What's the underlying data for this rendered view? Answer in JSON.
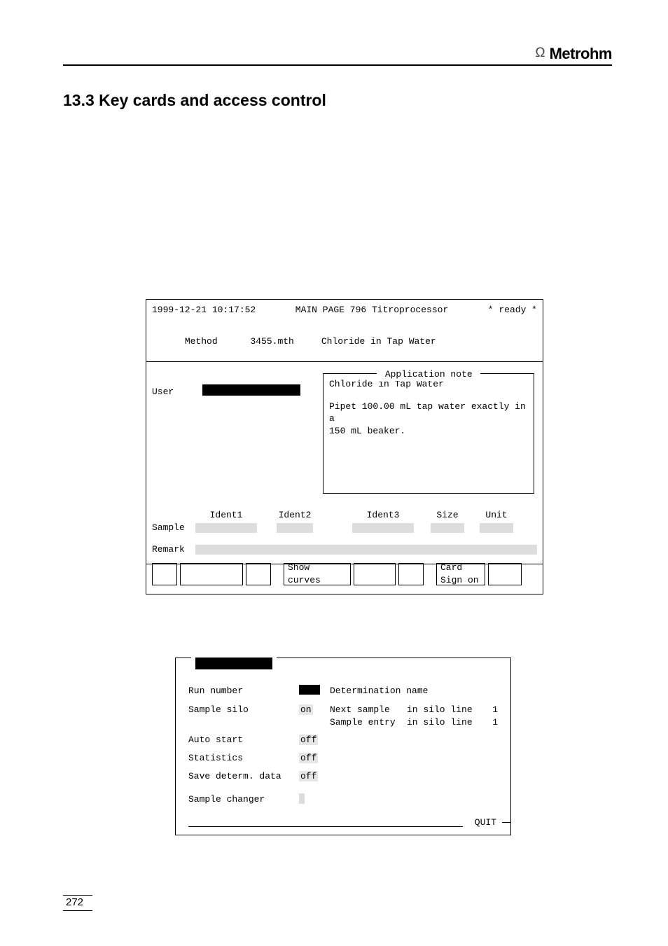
{
  "header": {
    "brand": "Metrohm"
  },
  "section": {
    "number": "13.3",
    "title": "Key cards and access control"
  },
  "panel": {
    "datetime": "1999-12-21 10:17:52",
    "main_page": "MAIN PAGE 796 Titroprocessor",
    "status": "* ready *",
    "method_label": "Method",
    "method_file": "3455.mth",
    "method_name": "Chloride in Tap Water",
    "user_label": "User",
    "note_title": "Application note",
    "note_line1": "Chloride in Tap Water",
    "note_line2": "Pipet 100.00 mL tap water exactly in a",
    "note_line3": "150 mL beaker.",
    "ident_headers": {
      "ident1": "Ident1",
      "ident2": "Ident2",
      "ident3": "Ident3",
      "size": "Size",
      "unit": "Unit"
    },
    "labels": {
      "sample": "Sample",
      "remark": "Remark"
    },
    "buttons": {
      "show_curves": "Show\ncurves",
      "card_signon": "Card\nSign on"
    }
  },
  "config": {
    "rows": {
      "run_number_label": "Run number",
      "det_name_label": "Determination name",
      "sample_silo_label": "Sample silo",
      "sample_silo_val": "on",
      "next_sample_label": "Next sample",
      "in_silo_line_label": "in silo line",
      "next_sample_val": "1",
      "sample_entry_label": "Sample entry",
      "sample_entry_val": "1",
      "auto_start_label": "Auto start",
      "auto_start_val": "off",
      "statistics_label": "Statistics",
      "statistics_val": "off",
      "save_determ_label": "Save determ. data",
      "save_determ_val": "off",
      "sample_changer_label": "Sample changer"
    },
    "quit": "QUIT"
  },
  "page_number": "272"
}
